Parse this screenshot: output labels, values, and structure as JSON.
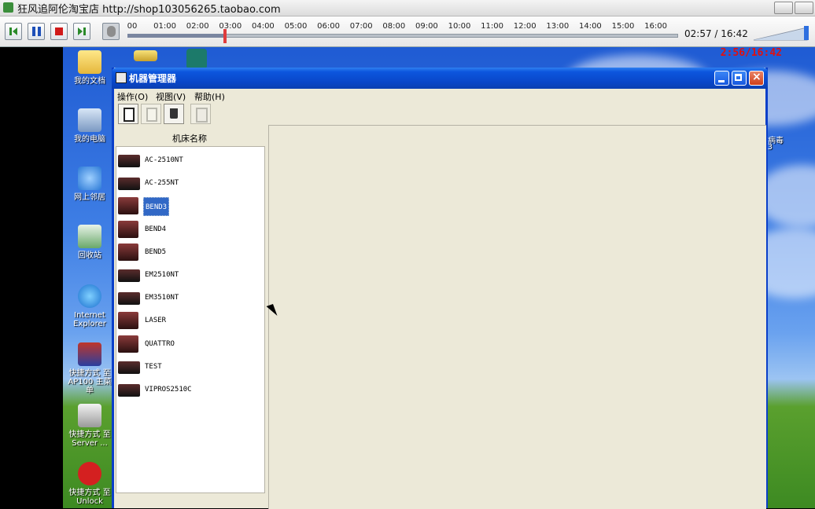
{
  "player": {
    "title": "狂风追阿伦淘宝店 http://shop103056265.taobao.com",
    "timeline_ticks": [
      "00",
      "01:00",
      "02:00",
      "03:00",
      "04:00",
      "05:00",
      "06:00",
      "07:00",
      "08:00",
      "09:00",
      "10:00",
      "11:00",
      "12:00",
      "13:00",
      "14:00",
      "15:00",
      "16:00"
    ],
    "timecode": "02:57 / 16:42",
    "progress_fraction": 0.177,
    "buttons": [
      "skip-start",
      "pause",
      "stop",
      "skip-end",
      "webcam"
    ]
  },
  "overlay_time": "2:56/16:42",
  "desktop": {
    "icons": [
      {
        "name": "my-documents",
        "label": "我的文档"
      },
      {
        "name": "my-computer",
        "label": "我的电脑"
      },
      {
        "name": "network",
        "label": "网上邻居"
      },
      {
        "name": "recycle-bin",
        "label": "回收站"
      },
      {
        "name": "internet-explorer",
        "label": "Internet Explorer"
      },
      {
        "name": "ap100-shortcut",
        "label": "快捷方式 至 AP100 主菜单"
      },
      {
        "name": "server-shortcut",
        "label": "快捷方式 至 Server ..."
      },
      {
        "name": "unlock-shortcut",
        "label": "快捷方式 至 Unlock"
      }
    ],
    "right_icon_label": "病毒",
    "right_icon_sub": "3"
  },
  "window": {
    "title": "机器管理器",
    "menu": [
      "操作(O)",
      "视图(V)",
      "帮助(H)"
    ],
    "toolbar": [
      "copy",
      "paste",
      "delete",
      "properties"
    ],
    "tree_header": "机床名称",
    "machines": [
      {
        "label": "AC-2510NT",
        "selected": false,
        "big": false
      },
      {
        "label": "AC-255NT",
        "selected": false,
        "big": false
      },
      {
        "label": "BEND3",
        "selected": true,
        "big": true
      },
      {
        "label": "BEND4",
        "selected": false,
        "big": true
      },
      {
        "label": "BEND5",
        "selected": false,
        "big": true
      },
      {
        "label": "EM2510NT",
        "selected": false,
        "big": false
      },
      {
        "label": "EM3510NT",
        "selected": false,
        "big": false
      },
      {
        "label": "LASER",
        "selected": false,
        "big": true
      },
      {
        "label": "QUATTRO",
        "selected": false,
        "big": true
      },
      {
        "label": "TEST",
        "selected": false,
        "big": false
      },
      {
        "label": "VIPROS2510C",
        "selected": false,
        "big": false
      }
    ]
  },
  "colors": {
    "accent": "#0a3fc9",
    "selection": "#3168c6",
    "overlay": "#e01010"
  }
}
